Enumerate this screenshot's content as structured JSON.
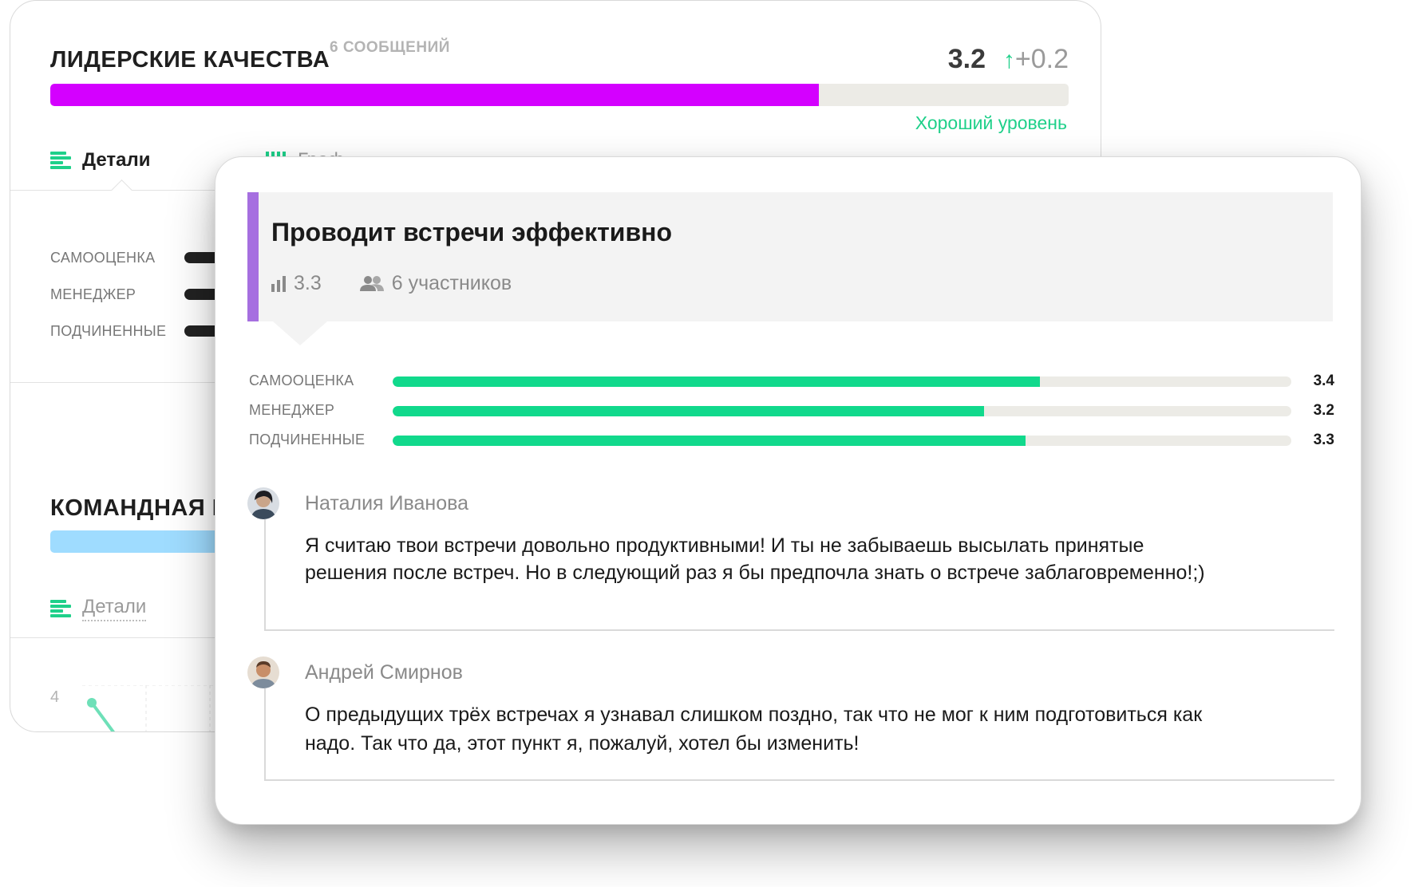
{
  "back_card": {
    "section1": {
      "title": "ЛИДЕРСКИЕ КАЧЕСТВА",
      "messages": "6 СООБЩЕНИЙ",
      "score": "3.2",
      "delta_arrow": "↑",
      "delta": "+0.2",
      "progress_fraction": 0.755,
      "level": "Хороший уровень",
      "tab_details": "Детали",
      "tab_other": "Граф",
      "rows": [
        {
          "label": "САМООЦЕНКА"
        },
        {
          "label": "МЕНЕДЖЕР"
        },
        {
          "label": "ПОДЧИНЕННЫЕ"
        }
      ]
    },
    "section2": {
      "title": "КОМАНДНАЯ Р",
      "tab_details": "Детали",
      "chart_tick": "4"
    }
  },
  "front_card": {
    "question": {
      "title": "Проводит встречи эффективно",
      "score": "3.3",
      "participants": "6 участников"
    },
    "scores": [
      {
        "label": "САМООЦЕНКА",
        "value": "3.4",
        "fraction": 0.72
      },
      {
        "label": "МЕНЕДЖЕР",
        "value": "3.2",
        "fraction": 0.658
      },
      {
        "label": "ПОДЧИНЕННЫЕ",
        "value": "3.3",
        "fraction": 0.704
      }
    ],
    "comments": [
      {
        "author": "Наталия Иванова",
        "text_line1": "Я считаю твои встречи довольно продуктивными! И ты не забываешь высылать принятые",
        "text_line2": "решения после встреч. Но в следующий раз я бы предпочла знать о встрече заблаговременно!;)"
      },
      {
        "author": "Андрей Смирнов",
        "text_line1": "О предыдущих трёх встречах я узнавал слишком поздно, так что не мог к ним подготовиться как",
        "text_line2": "надо. Так что да, этот пункт я, пожалуй, хотел бы изменить!"
      }
    ]
  },
  "colors": {
    "accent_green": "#11d98c",
    "magenta_bar": "#d400ff",
    "light_blue_bar": "#9fdcff",
    "question_accent": "#a66fe0"
  }
}
